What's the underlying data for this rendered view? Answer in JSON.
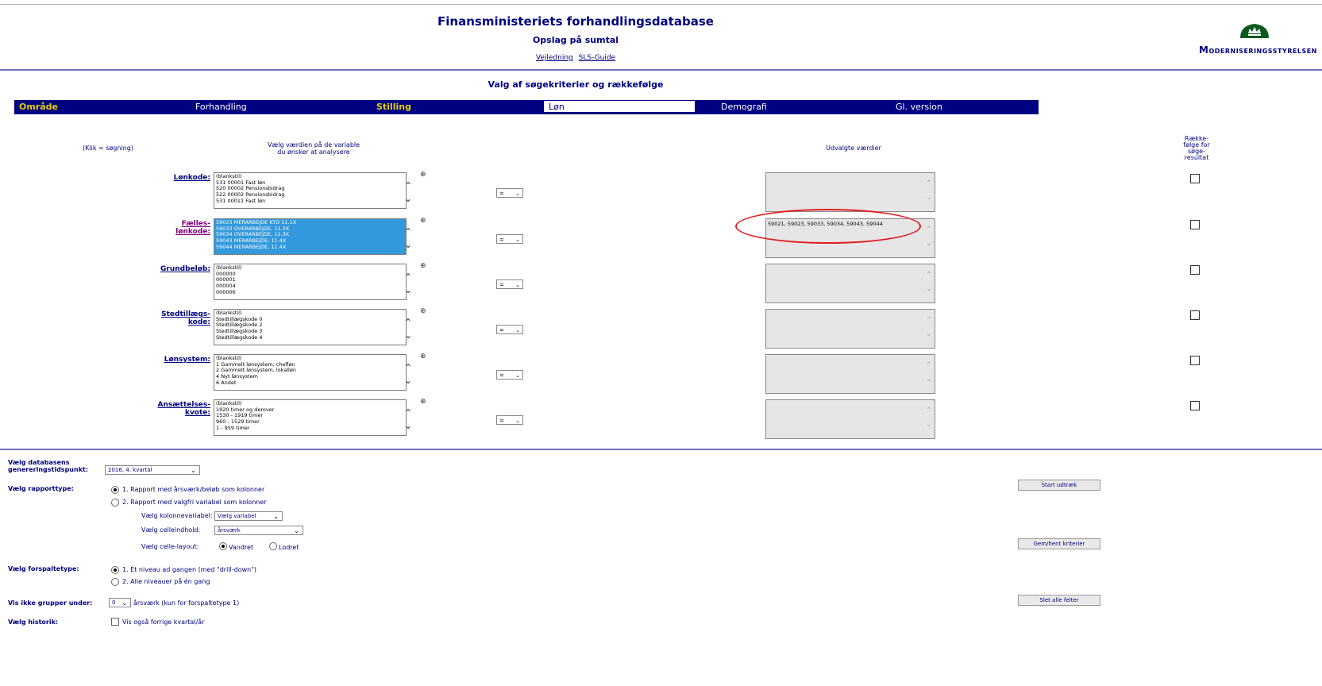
{
  "header": {
    "title": "Finansministeriets forhandlingsdatabase",
    "subtitle": "Opslag på sumtal",
    "links": [
      "Vejledning",
      "SLS-Guide"
    ],
    "logo_text": "Moderniseringsstyrelsen"
  },
  "section_title": "Valg af søgekriterier og rækkefølge",
  "tabs": [
    "Område",
    "Forhandling",
    "Stilling",
    "Løn",
    "Demografi",
    "Gl. version"
  ],
  "columns": {
    "hint": "(Klik = søgning)",
    "choose": [
      "Vælg værdien på de variable",
      "du ønsker at analysere"
    ],
    "selected": "Udvalgte værdier",
    "order": [
      "Række-",
      "følge for",
      "søge-",
      "resultat"
    ]
  },
  "variables": [
    {
      "label": [
        "Lønkode:"
      ],
      "options": [
        "(blankstil)",
        "531 00001 Fast løn",
        "520 00002 Pensionsbidrag",
        "522 00002 Pensionsbidrag",
        "531 00011 Fast løn"
      ],
      "operator": "=",
      "selected_values": ""
    },
    {
      "label": [
        "Fælles-",
        "lønkode:"
      ],
      "options": [
        "59023 MERARBEJDE KTO 11.1X",
        "59033 OVERARBEJDE, 11.3X",
        "59034 OVERARBEJDE, 11.3X",
        "59043 MERARBEJDE, 11.4X",
        "59044 MERARBEJDE, 11.4X"
      ],
      "operator": "=",
      "selected_values": "59021, 59023, 59033, 59034, 59043, 59044"
    },
    {
      "label": [
        "Grundbeløb:"
      ],
      "options": [
        "(blankstil)",
        "000000",
        "000001",
        "000004",
        "000006"
      ],
      "operator": "=",
      "selected_values": ""
    },
    {
      "label": [
        "Stedtillægs-",
        "kode:"
      ],
      "options": [
        "(blankstil)",
        "Stedtillægskode 0",
        "Stedtillægskode 2",
        "Stedtillægskode 3",
        "Stedtillægskode 4"
      ],
      "operator": "=",
      "selected_values": ""
    },
    {
      "label": [
        "Lønsystem:"
      ],
      "options": [
        "(blankstil)",
        "1 Gammelt lønsystem, chefløn",
        "2 Gammelt lønsystem, lokalløn",
        "4 Nyt lønsystem",
        "6 Andet"
      ],
      "operator": "=",
      "selected_values": ""
    },
    {
      "label": [
        "Ansættelses-",
        "kvote:"
      ],
      "options": [
        "(blankstil)",
        "1920 timer og derover",
        "1530 - 1919 timer",
        "960 - 1529 timer",
        "1 - 959 timer"
      ],
      "operator": "=",
      "selected_values": ""
    }
  ],
  "bottom": {
    "db_time_label": [
      "Vælg databasens",
      "genereringstidspunkt:"
    ],
    "db_time_value": "2016, 4. kvartal",
    "report_type_label": "Vælg rapporttype:",
    "report_type_opt1": "1. Rapport med årsværk/beløb som kolonner",
    "report_type_opt2": "2. Rapport med valgfri variabel som kolonner",
    "col_var_label": "Vælg kolonnevariabel:",
    "col_var_value": "Vælg variabel",
    "cell_content_label": "Vælg celleindhold:",
    "cell_content_value": "årsværk",
    "cell_layout_label": "Vælg celle-layout:",
    "cell_layout_opt1": "Vandret",
    "cell_layout_opt2": "Lodret",
    "forspalte_label": "Vælg forspaltetype:",
    "forspalte_opt1": "1. Ét niveau ad gangen (med \"drill-down\")",
    "forspalte_opt2": "2. Alle niveauer på én gang",
    "hide_groups_label": "Vis ikke grupper under:",
    "hide_groups_value": "0",
    "hide_groups_suffix": "årsværk (kun for forspaltetype 1)",
    "history_label": "Vælg historik:",
    "history_check": "Vis også forrige kvartal/år",
    "btn_start": "Start udtræk",
    "btn_save": "Gem/hent kriterier",
    "btn_clear": "Slet alle felter"
  }
}
